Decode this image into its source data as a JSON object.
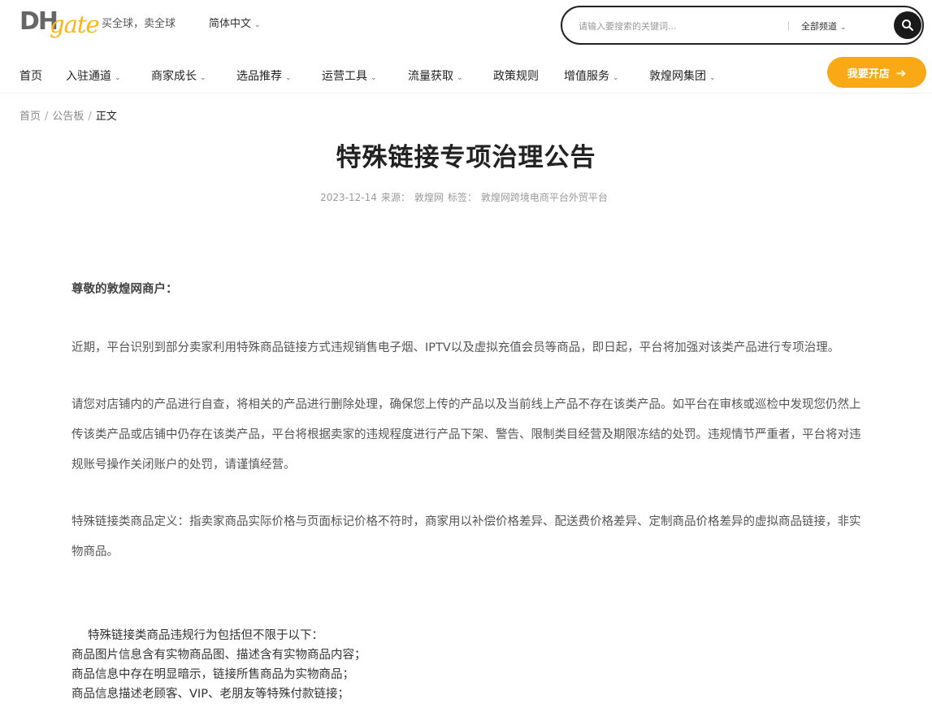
{
  "header": {
    "logo_dh": "DH",
    "logo_gate": "gate",
    "slogan": "买全球，卖全球",
    "language": "简体中文",
    "search_placeholder": "请输入要搜索的关键词...",
    "channel": "全部频道"
  },
  "nav": {
    "items": [
      {
        "label": "首页"
      },
      {
        "label": "入驻通道"
      },
      {
        "label": "商家成长"
      },
      {
        "label": "选品推荐"
      },
      {
        "label": "运营工具"
      },
      {
        "label": "流量获取"
      },
      {
        "label": "政策规则"
      },
      {
        "label": "增值服务"
      },
      {
        "label": "敦煌网集团"
      }
    ],
    "cta": "我要开店"
  },
  "breadcrumb": {
    "home": "首页",
    "board": "公告板",
    "current": "正文"
  },
  "article": {
    "title": "特殊链接专项治理公告",
    "date": "2023-12-14",
    "source_label": "来源：",
    "source": "敦煌网",
    "tag_label": "标签：",
    "tags": "敦煌网跨境电商平台外贸平台",
    "greeting": "尊敬的敦煌网商户：",
    "p1": "近期，平台识别到部分卖家利用特殊商品链接方式违规销售电子烟、IPTV以及虚拟充值会员等商品，即日起，平台将加强对该类产品进行专项治理。",
    "p2": "请您对店铺内的产品进行自查，将相关的产品进行删除处理，确保您上传的产品以及当前线上产品不存在该类产品。如平台在审核或巡检中发现您仍然上传该类产品或店铺中仍存在该类产品，平台将根据卖家的违规程度进行产品下架、警告、限制类目经营及期限冻结的处罚。违规情节严重者，平台将对违规账号操作关闭账户的处罚，请谨慎经营。",
    "p3": "特殊链接类商品定义：指卖家商品实际价格与页面标记价格不符时，商家用以补偿价格差异、配送费价格差异、定制商品价格差异的虚拟商品链接，非实物商品。",
    "list_lead": "特殊链接类商品违规行为包括但不限于以下：",
    "list": [
      "商品图片信息含有实物商品图、描述含有实物商品内容；",
      "商品信息中存在明显暗示，链接所售商品为实物商品；",
      "商品信息描述老顾客、VIP、老朋友等特殊付款链接；"
    ]
  },
  "colors": {
    "accent": "#f8a915",
    "logo_yellow": "#f8b51c",
    "search_border": "#222222"
  }
}
